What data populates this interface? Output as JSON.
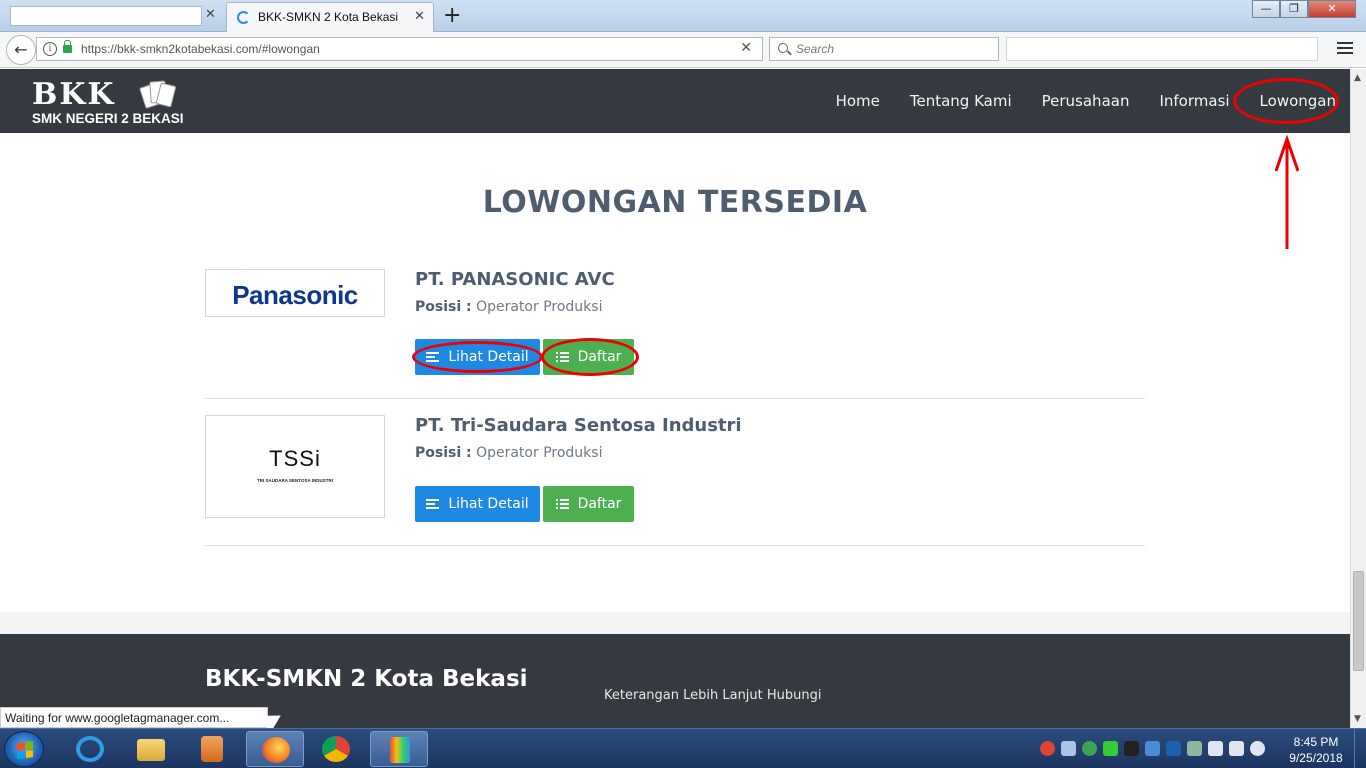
{
  "browser": {
    "active_tab_title": "BKK-SMKN 2 Kota Bekasi",
    "tab_close": "✕",
    "new_tab": "+",
    "url_host": "https://bkk-smkn2kotabekasi.com",
    "url_path": "/#lowongan",
    "search_placeholder": "Search",
    "win_min": "—",
    "win_max": "❐",
    "win_close": "✕",
    "back": "←",
    "url_clear": "✕",
    "info": "i"
  },
  "site": {
    "logo_main": "BKK",
    "logo_sub": "SMK NEGERI 2 BEKASI",
    "nav": [
      "Home",
      "Tentang Kami",
      "Perusahaan",
      "Informasi",
      "Lowongan"
    ]
  },
  "section": {
    "title": "LOWONGAN TERSEDIA"
  },
  "jobs": [
    {
      "company": "PT. PANASONIC AVC",
      "position_label": "Posisi :",
      "position": "Operator Produksi",
      "logo_text": "Panasonic",
      "detail_label": "Lihat Detail",
      "apply_label": "Daftar"
    },
    {
      "company": "PT. Tri-Saudara Sentosa Industri",
      "position_label": "Posisi :",
      "position": "Operator Produksi",
      "logo_text": "TSSi",
      "logo_subtext": "TRI SAUDARA SENTOSA INDUSTRI",
      "detail_label": "Lihat Detail",
      "apply_label": "Daftar"
    }
  ],
  "footer": {
    "title": "BKK-SMKN 2 Kota Bekasi",
    "info": "Keterangan Lebih Lanjut Hubungi"
  },
  "status": "Waiting for www.googletagmanager.com...",
  "clock": {
    "time": "8:45 PM",
    "date": "9/25/2018"
  },
  "colors": {
    "header_bg": "#343a40",
    "button_blue": "#1e88e5",
    "button_green": "#4caf50",
    "annotation_red": "#ee0000"
  }
}
